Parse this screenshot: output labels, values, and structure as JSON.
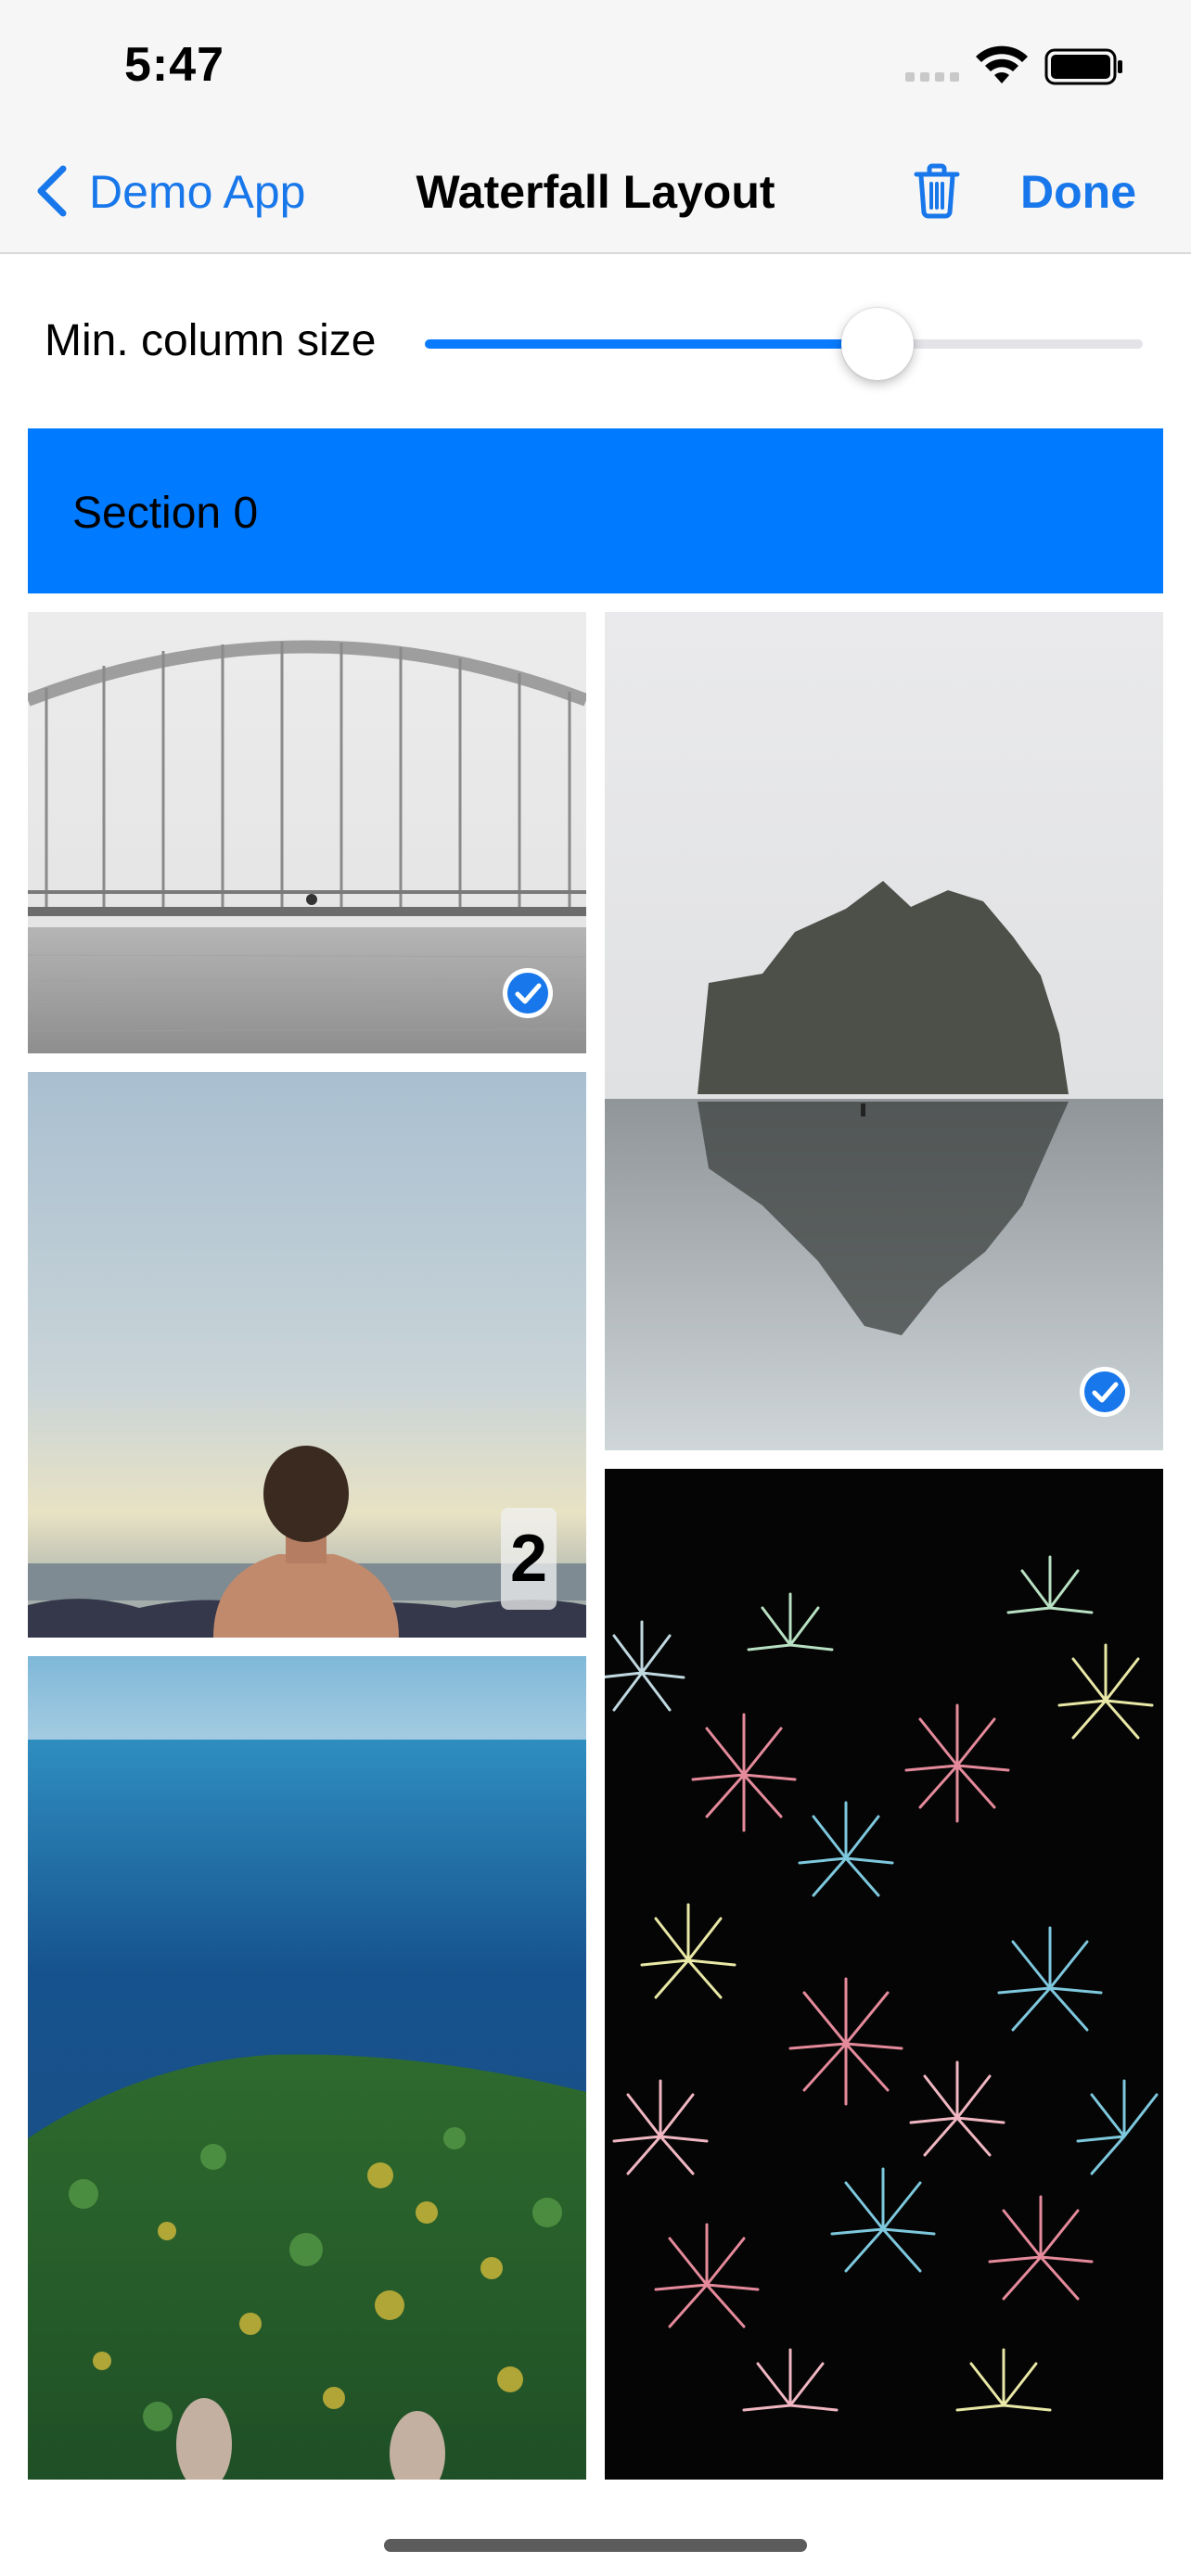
{
  "status_bar": {
    "time": "5:47"
  },
  "nav": {
    "back_label": "Demo App",
    "title": "Waterfall Layout",
    "done_label": "Done"
  },
  "controls": {
    "slider_label": "Min. column size",
    "slider_fraction": 0.63
  },
  "section": {
    "title": "Section 0"
  },
  "photos": [
    {
      "subject": "bridge-over-water",
      "selected": true,
      "badge": ""
    },
    {
      "subject": "rock-island-reflection",
      "selected": true,
      "badge": ""
    },
    {
      "subject": "man-at-sea",
      "selected": false,
      "badge": "2"
    },
    {
      "subject": "fireworks",
      "selected": false,
      "badge": ""
    },
    {
      "subject": "forest-and-ocean",
      "selected": false,
      "badge": ""
    }
  ],
  "colors": {
    "accent": "#1877ea",
    "section_background": "#007bff",
    "slider_fill": "#0a7bff"
  },
  "icons": [
    "chevron-left-icon",
    "trash-icon",
    "checkmark-circle-icon",
    "wifi-icon",
    "battery-icon"
  ]
}
